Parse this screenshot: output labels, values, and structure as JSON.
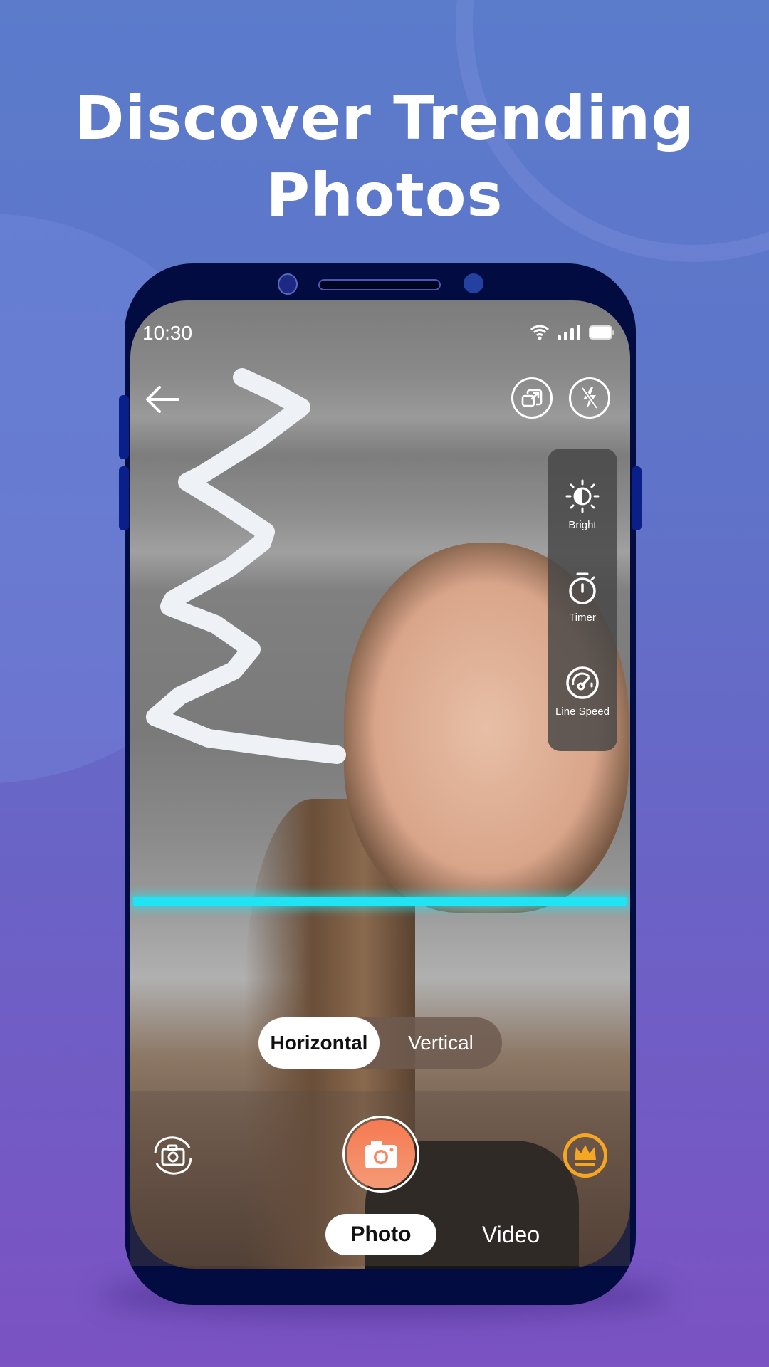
{
  "headline": {
    "line1": "Discover Trending",
    "line2": "Photos"
  },
  "status_bar": {
    "time": "10:30",
    "icons": [
      "wifi-icon",
      "signal-icon",
      "battery-icon"
    ]
  },
  "top_controls": {
    "back": "arrow-left-icon",
    "resize": "resize-window-icon",
    "flash": "flash-off-icon"
  },
  "tools": [
    {
      "icon": "brightness-icon",
      "label": "Bright"
    },
    {
      "icon": "timer-icon",
      "label": "Timer"
    },
    {
      "icon": "speedometer-icon",
      "label": "Line Speed"
    }
  ],
  "orientation": {
    "options": [
      "Horizontal",
      "Vertical"
    ],
    "selected": "Horizontal"
  },
  "capture": {
    "flip_icon": "flip-camera-icon",
    "shutter_icon": "camera-icon",
    "premium_icon": "crown-icon"
  },
  "modes": {
    "options": [
      "Photo",
      "Video"
    ],
    "selected": "Photo"
  },
  "colors": {
    "background_top": "#5b7bcb",
    "background_bottom": "#7b52c2",
    "phone_body": "#020c40",
    "scan_line": "#20e4f4",
    "shutter": "#f57a52",
    "premium": "#f5a623"
  }
}
